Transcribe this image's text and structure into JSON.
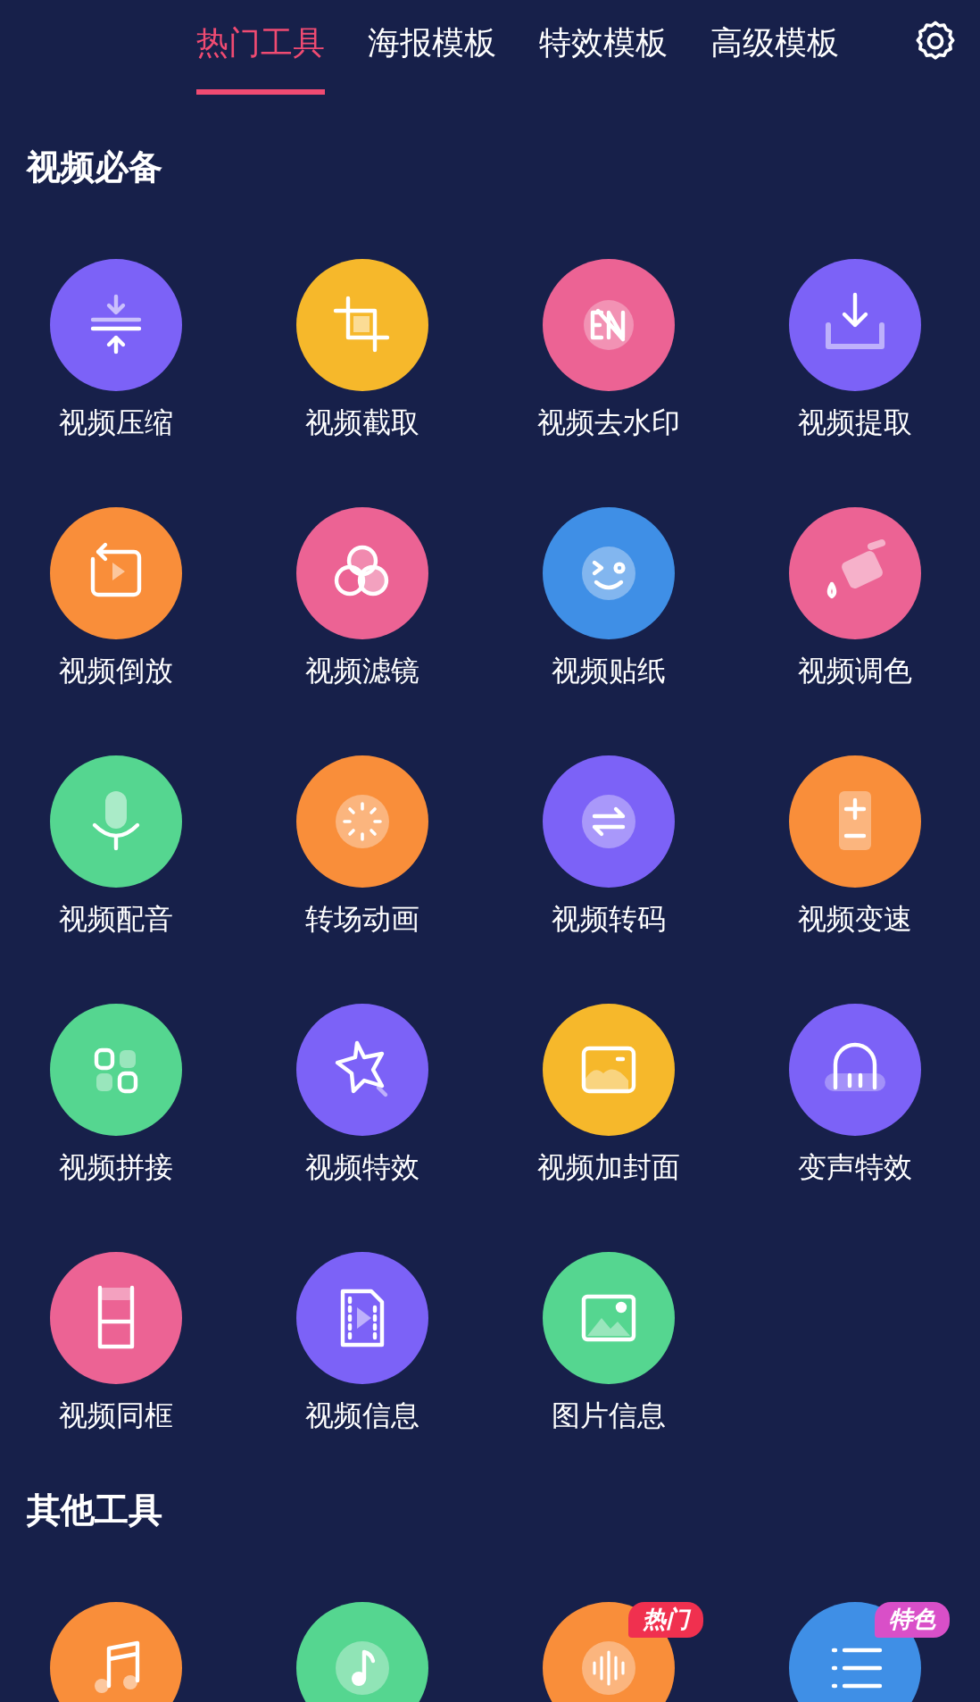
{
  "tabs": [
    {
      "label": "热门工具",
      "selected": true
    },
    {
      "label": "海报模板",
      "selected": false
    },
    {
      "label": "特效模板",
      "selected": false
    },
    {
      "label": "高级模板",
      "selected": false
    }
  ],
  "sections": [
    {
      "title": "视频必备",
      "tools": [
        {
          "label": "视频压缩",
          "kind": "compress",
          "color": "#7c62f7"
        },
        {
          "label": "视频截取",
          "kind": "crop",
          "color": "#f6b82b"
        },
        {
          "label": "视频去水印",
          "kind": "watermark",
          "color": "#ec6394"
        },
        {
          "label": "视频提取",
          "kind": "extract",
          "color": "#7c62f7"
        },
        {
          "label": "视频倒放",
          "kind": "reverse",
          "color": "#f98e3a"
        },
        {
          "label": "视频滤镜",
          "kind": "filter",
          "color": "#ec6394"
        },
        {
          "label": "视频贴纸",
          "kind": "sticker",
          "color": "#3f8fe6"
        },
        {
          "label": "视频调色",
          "kind": "palette",
          "color": "#ec6394"
        },
        {
          "label": "视频配音",
          "kind": "mic",
          "color": "#55d690"
        },
        {
          "label": "转场动画",
          "kind": "transition",
          "color": "#f98e3a"
        },
        {
          "label": "视频转码",
          "kind": "convert",
          "color": "#7c62f7"
        },
        {
          "label": "视频变速",
          "kind": "speed",
          "color": "#f98e3a"
        },
        {
          "label": "视频拼接",
          "kind": "merge",
          "color": "#55d690"
        },
        {
          "label": "视频特效",
          "kind": "star",
          "color": "#7c62f7"
        },
        {
          "label": "视频加封面",
          "kind": "cover",
          "color": "#f6b82b"
        },
        {
          "label": "变声特效",
          "kind": "headphones",
          "color": "#7c62f7"
        },
        {
          "label": "视频同框",
          "kind": "frame",
          "color": "#ec6394"
        },
        {
          "label": "视频信息",
          "kind": "film",
          "color": "#7c62f7"
        },
        {
          "label": "图片信息",
          "kind": "image",
          "color": "#55d690"
        }
      ]
    },
    {
      "title": "其他工具",
      "tools": [
        {
          "kind": "music",
          "color": "#f98e3a"
        },
        {
          "kind": "note",
          "color": "#55d690"
        },
        {
          "kind": "wave",
          "color": "#f98e3a",
          "badge": {
            "text": "热门",
            "color": "#f0304f"
          }
        },
        {
          "kind": "list",
          "color": "#3f8fe6",
          "badge": {
            "text": "特色",
            "color": "#d94fc8"
          }
        }
      ]
    }
  ]
}
